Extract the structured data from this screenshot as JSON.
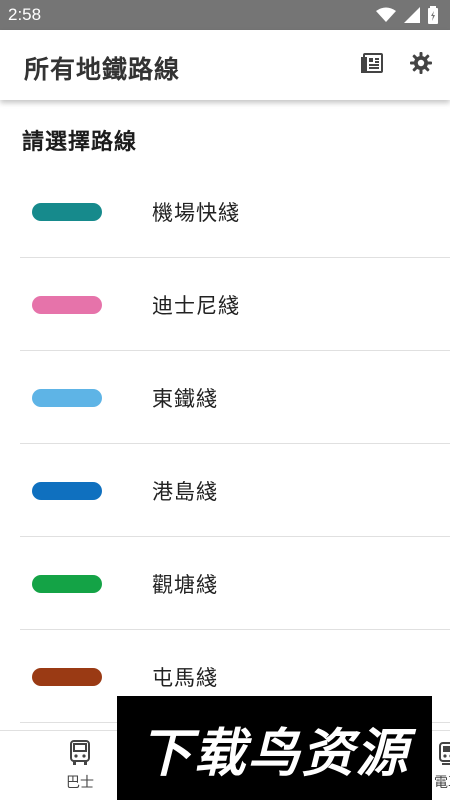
{
  "status_bar": {
    "time": "2:58",
    "icons": [
      "wifi-icon",
      "signal-icon",
      "battery-icon"
    ]
  },
  "app_bar": {
    "title": "所有地鐵路線",
    "actions": [
      "news-icon",
      "settings-gear-icon"
    ]
  },
  "main": {
    "section_title": "請選擇路線",
    "lines": [
      {
        "name": "機場快綫",
        "color": "#168a8c"
      },
      {
        "name": "迪士尼綫",
        "color": "#e673aa"
      },
      {
        "name": "東鐵綫",
        "color": "#5eb4e6"
      },
      {
        "name": "港島綫",
        "color": "#0f70bf"
      },
      {
        "name": "觀塘綫",
        "color": "#14a346"
      },
      {
        "name": "屯馬綫",
        "color": "#9a3a14"
      }
    ]
  },
  "bottom_nav": {
    "items": [
      {
        "label": "巴士",
        "icon": "bus-icon"
      },
      {
        "label": "電車",
        "icon": "tram-icon"
      }
    ]
  },
  "watermark": {
    "text": "下载鸟资源"
  }
}
